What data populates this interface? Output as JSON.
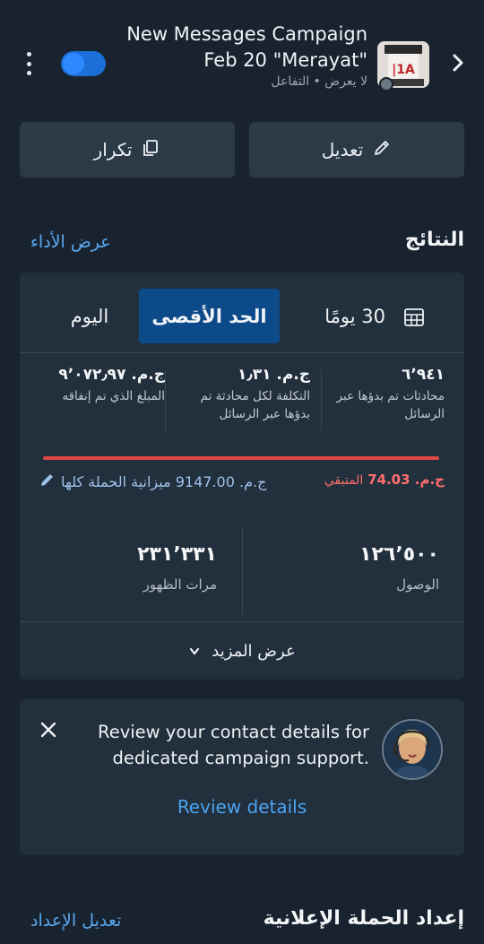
{
  "header": {
    "title_line1": "New Messages Campaign",
    "title_line2": "Feb 20 \"Merayat\"",
    "subtitle": "لا يعرض • التفاعل",
    "toggle_on": true
  },
  "actions": {
    "edit_label": "تعديل",
    "duplicate_label": "تكرار"
  },
  "results": {
    "title": "النتائج",
    "view_performance": "عرض الأداء",
    "tabs": {
      "days30": "30 يومًا",
      "max": "الحد الأقصى",
      "today": "اليوم"
    },
    "selected_tab": "max",
    "metrics": [
      {
        "value": "٦٬٩٤١",
        "label": "محادثات تم بدؤها عبر الرسائل"
      },
      {
        "value": "ج.م. ١٫٣١",
        "label": "التكلفة لكل محادثة تم بدؤها عبر الرسائل"
      },
      {
        "value": "ج.م. ٩٬٠٧٢٫٩٧",
        "label": "المبلغ الذي تم إنفاقه"
      }
    ],
    "remaining_amount": "ج.م. 74.03",
    "remaining_label": "المتبقي",
    "budget_text": "ج.م. 9147.00 ميزانية الحملة كلها",
    "spent_fraction": 0.992,
    "stats": [
      {
        "value": "١٢٦٬٥٠٠",
        "label": "الوصول"
      },
      {
        "value": "٢٣١٬٣٣١",
        "label": "مرات الظهور"
      }
    ],
    "see_more": "عرض المزيد"
  },
  "support": {
    "message": "Review your contact details for dedicated campaign support.",
    "link": "Review details"
  },
  "setup": {
    "title": "إعداد الحملة الإعلانية",
    "edit_link": "تعديل الإعداد"
  },
  "colors": {
    "background": "#18232f",
    "card": "#222f3c",
    "accent": "#0c4a8a",
    "link": "#5aa7f0",
    "danger": "#e04848"
  }
}
